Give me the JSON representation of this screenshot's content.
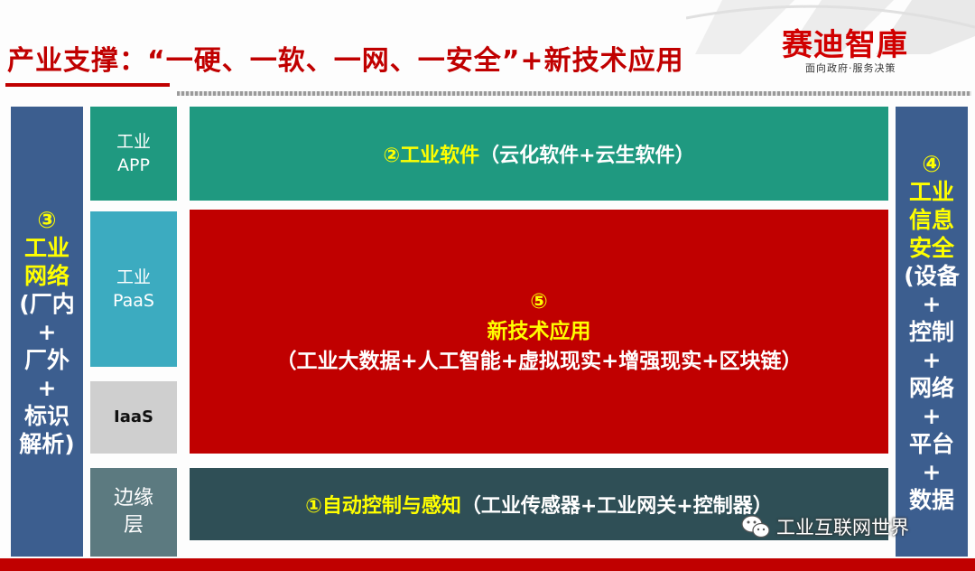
{
  "title": "产业支撑：“一硬、一软、一网、一安全”+新技术应用",
  "logo": {
    "name": "赛迪智庫",
    "tagline": "面向政府·服务决策"
  },
  "left_panel": {
    "number": "③",
    "title_lines": [
      "工业",
      "网络"
    ],
    "detail_lines": [
      "(厂内",
      "+",
      "厂外",
      "+",
      "标识",
      "解析)"
    ]
  },
  "right_panel": {
    "number": "④",
    "title_lines": [
      "工业",
      "信息",
      "安全"
    ],
    "detail_lines": [
      "(设备",
      "+",
      "控制",
      "+",
      "网络",
      "+",
      "平台",
      "+",
      "数据"
    ]
  },
  "stack": {
    "app": [
      "工业",
      "APP"
    ],
    "paas": [
      "工业",
      "PaaS"
    ],
    "iaas": "IaaS",
    "edge": [
      "边缘",
      "层"
    ]
  },
  "bands": {
    "software": {
      "title": "②工业软件",
      "detail": "（云化软件+云生软件）"
    },
    "new_tech": {
      "number": "⑤",
      "title": "新技术应用",
      "detail": "（工业大数据+人工智能+虚拟现实+增强现实+区块链）"
    },
    "control": {
      "title": "①自动控制与感知",
      "detail": "（工业传感器+工业网关+控制器）"
    }
  },
  "watermark": "工业互联网世界",
  "colors": {
    "title_red": "#c00000",
    "side_blue": "#3c5e8f",
    "teal": "#1f9980",
    "light_teal": "#3cabc0",
    "gray": "#cfcfcf",
    "slate": "#5c7a80",
    "dark_teal": "#2f4f56",
    "highlight_yellow": "#ffff00"
  },
  "icons": {
    "watermark": "wechat-icon"
  }
}
